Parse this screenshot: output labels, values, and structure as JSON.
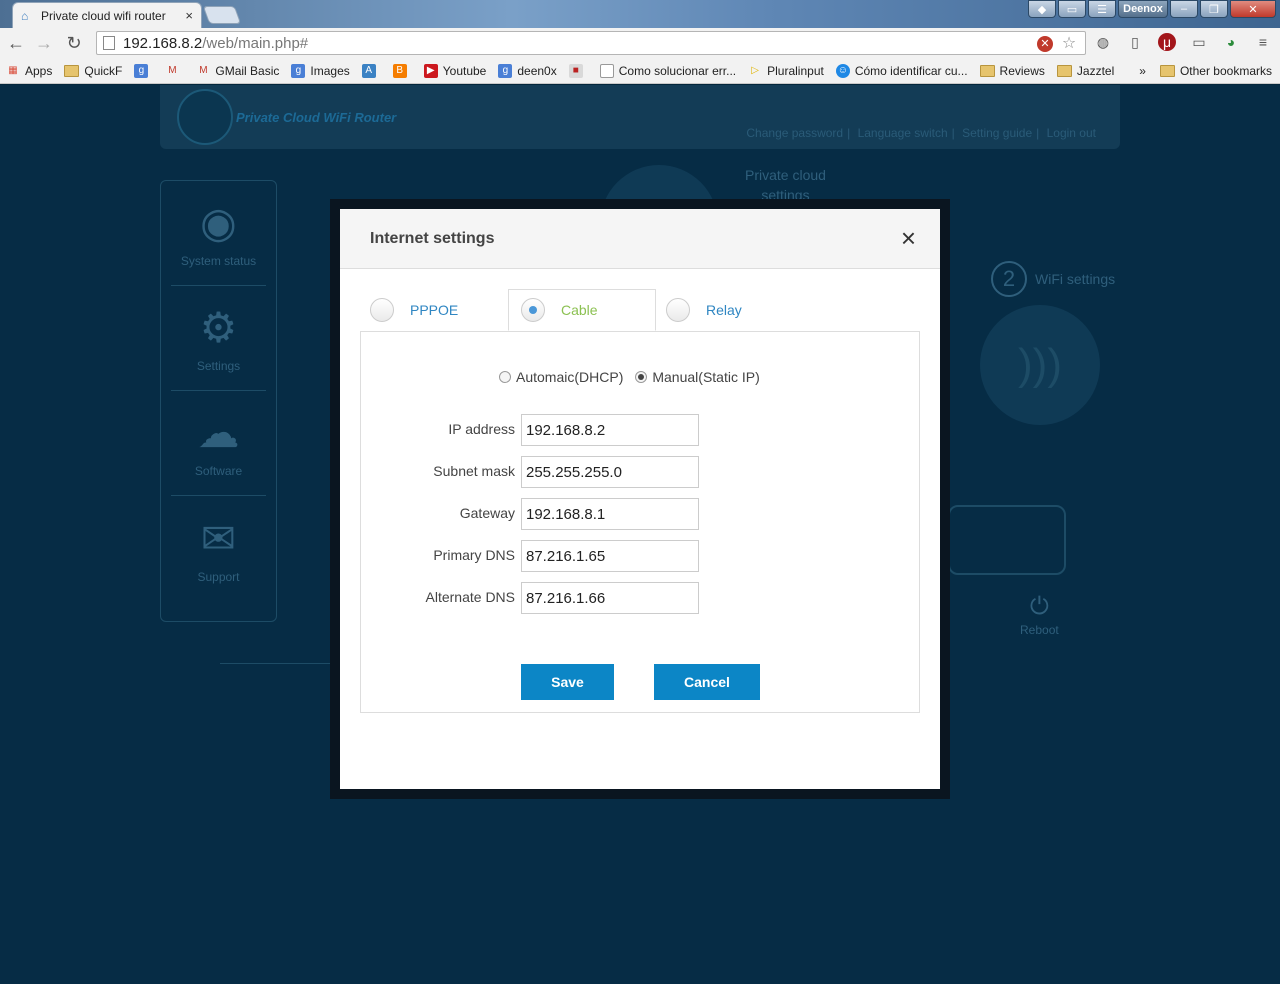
{
  "browser": {
    "tab_title": "Private cloud wifi router",
    "tab_close": "×",
    "profile_name": "Deenox",
    "url_host": "192.168.8.2",
    "url_path": "/web/main.php#",
    "bookmarks": [
      {
        "label": "Apps"
      },
      {
        "label": "QuickF"
      },
      {
        "label": ""
      },
      {
        "label": ""
      },
      {
        "label": "GMail Basic"
      },
      {
        "label": "Images"
      },
      {
        "label": ""
      },
      {
        "label": ""
      },
      {
        "label": "Youtube"
      },
      {
        "label": "deen0x"
      },
      {
        "label": ""
      },
      {
        "label": "Como solucionar err..."
      },
      {
        "label": "Pluralinput"
      },
      {
        "label": "Cómo identificar cu..."
      },
      {
        "label": "Reviews"
      },
      {
        "label": "Jazztel"
      }
    ],
    "bookmarks_overflow": "»",
    "other_bookmarks": "Other bookmarks"
  },
  "router": {
    "logo_text": "Private Cloud WiFi Router",
    "header_links": [
      "Change password",
      "Language switch",
      "Setting guide",
      "Login out"
    ],
    "sidebar": [
      "System status",
      "Settings",
      "Software",
      "Support"
    ],
    "cloud_label_1": "Private cloud",
    "cloud_label_2": "settings",
    "wifi_step": "2",
    "wifi_label": "WiFi settings",
    "reboot_label": "Reboot"
  },
  "modal": {
    "title": "Internet settings",
    "close": "×",
    "tabs": {
      "pppoe": "PPPOE",
      "cable": "Cable",
      "relay": "Relay",
      "selected": "Cable"
    },
    "ip_mode": {
      "auto": "Automaic(DHCP)",
      "manual": "Manual(Static IP)",
      "selected": "Manual(Static IP)"
    },
    "fields": {
      "ip_label": "IP address",
      "ip_value": "192.168.8.2",
      "mask_label": "Subnet mask",
      "mask_value": "255.255.255.0",
      "gateway_label": "Gateway",
      "gateway_value": "192.168.8.1",
      "dns1_label": "Primary DNS",
      "dns1_value": "87.216.1.65",
      "dns2_label": "Alternate DNS",
      "dns2_value": "87.216.1.66"
    },
    "save": "Save",
    "cancel": "Cancel"
  }
}
